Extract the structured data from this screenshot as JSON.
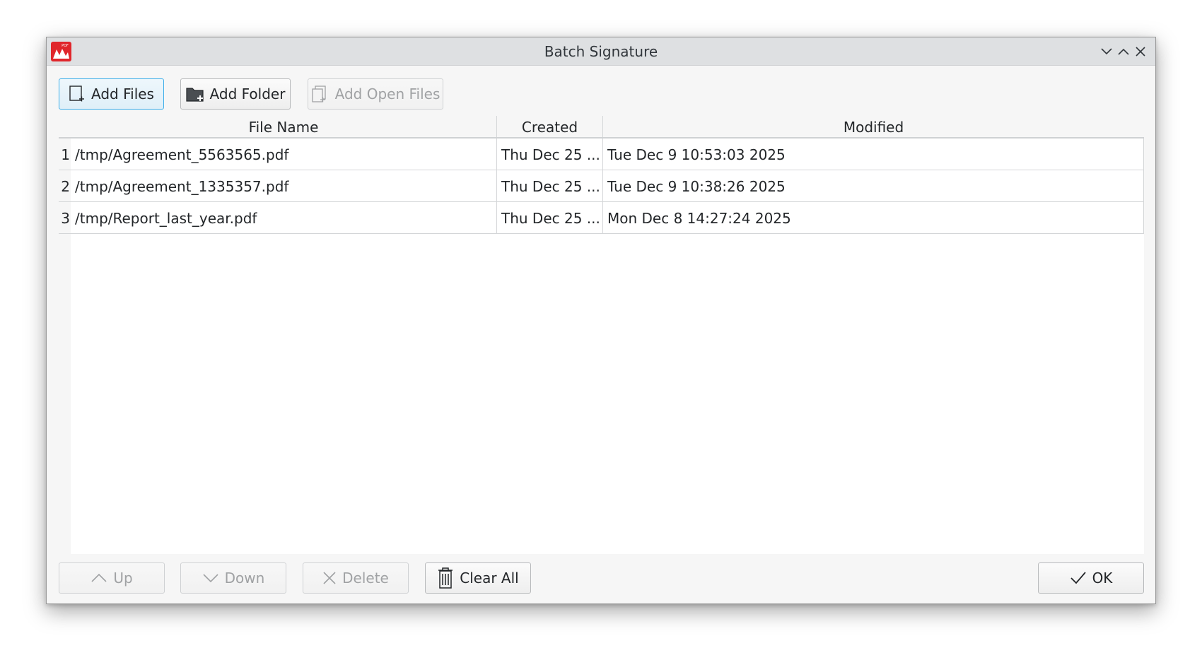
{
  "window": {
    "title": "Batch Signature",
    "logo_icon": "pdf-app-logo-icon",
    "logo_text": "PDF"
  },
  "toolbar": {
    "add_files": "Add Files",
    "add_folder": "Add Folder",
    "add_open_files": "Add Open Files"
  },
  "table": {
    "columns": [
      "File Name",
      "Created",
      "Modified"
    ],
    "rows": [
      {
        "num": "1",
        "file": "/tmp/Agreement_5563565.pdf",
        "created": "Thu Dec 25 ...",
        "modified": "Tue Dec 9 10:53:03 2025"
      },
      {
        "num": "2",
        "file": "/tmp/Agreement_1335357.pdf",
        "created": "Thu Dec 25 ...",
        "modified": "Tue Dec 9 10:38:26 2025"
      },
      {
        "num": "3",
        "file": "/tmp/Report_last_year.pdf",
        "created": "Thu Dec 25 ...",
        "modified": "Mon Dec 8 14:27:24 2025"
      }
    ]
  },
  "footer": {
    "up": "Up",
    "down": "Down",
    "delete": "Delete",
    "clear_all": "Clear All",
    "ok": "OK"
  },
  "colors": {
    "accent": "#3daee9",
    "logo_red": "#e0262b"
  }
}
